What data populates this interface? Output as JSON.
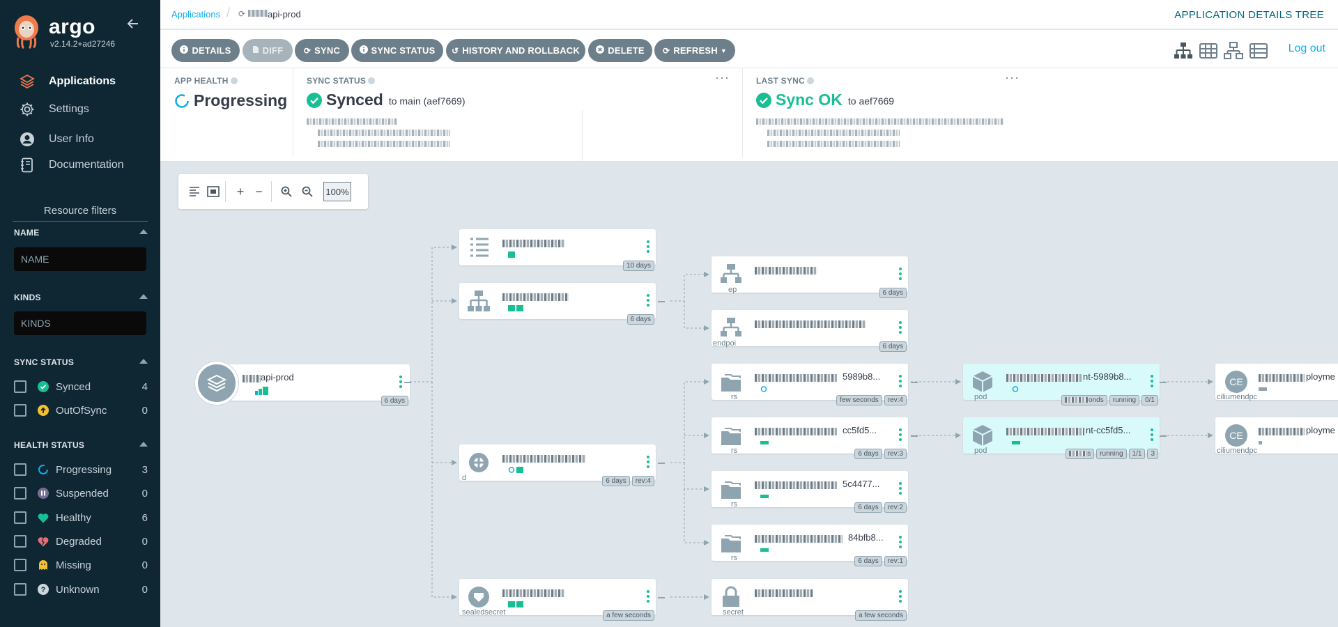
{
  "brand": {
    "name": "argo",
    "version": "v2.14.2+ad27246"
  },
  "nav": [
    {
      "label": "Applications",
      "icon": "layers-icon",
      "active": true
    },
    {
      "label": "Settings",
      "icon": "gear-icon",
      "active": false
    },
    {
      "label": "User Info",
      "icon": "user-circle-icon",
      "active": false
    },
    {
      "label": "Documentation",
      "icon": "book-icon",
      "active": false
    }
  ],
  "filters": {
    "title": "Resource filters",
    "name": {
      "label": "NAME",
      "placeholder": "NAME"
    },
    "kinds": {
      "label": "KINDS",
      "placeholder": "KINDS"
    },
    "sync_status": {
      "label": "SYNC STATUS",
      "items": [
        {
          "label": "Synced",
          "count": "4",
          "icon": "check-circle-icon"
        },
        {
          "label": "OutOfSync",
          "count": "0",
          "icon": "arrow-up-circle-icon"
        }
      ]
    },
    "health_status": {
      "label": "HEALTH STATUS",
      "items": [
        {
          "label": "Progressing",
          "count": "3",
          "icon": "progress-ring-icon"
        },
        {
          "label": "Suspended",
          "count": "0",
          "icon": "pause-circle-icon"
        },
        {
          "label": "Healthy",
          "count": "6",
          "icon": "heart-icon"
        },
        {
          "label": "Degraded",
          "count": "0",
          "icon": "broken-heart-icon"
        },
        {
          "label": "Missing",
          "count": "0",
          "icon": "ghost-icon"
        },
        {
          "label": "Unknown",
          "count": "0",
          "icon": "question-circle-icon"
        }
      ]
    }
  },
  "breadcrumb": {
    "root": "Applications",
    "current": "api-prod"
  },
  "page_title": "APPLICATION DETAILS TREE",
  "toolbar": {
    "details": "DETAILS",
    "diff": "DIFF",
    "sync": "SYNC",
    "sync_status": "SYNC STATUS",
    "history": "HISTORY AND ROLLBACK",
    "delete": "DELETE",
    "refresh": "REFRESH",
    "logout": "Log out"
  },
  "status": {
    "app_health": {
      "label": "APP HEALTH",
      "value": "Progressing"
    },
    "sync_status": {
      "label": "SYNC STATUS",
      "value": "Synced",
      "sub": "to main (aef7669)"
    },
    "last_sync": {
      "label": "LAST SYNC",
      "value": "Sync OK",
      "sub": "to aef7669"
    }
  },
  "zoom": {
    "level": "100%"
  },
  "graph": {
    "root": {
      "name": "api-prod",
      "age": "6 days"
    },
    "nodes": {
      "configmap": {
        "kind": "",
        "age": "10 days"
      },
      "service": {
        "kind": "",
        "age": "6 days"
      },
      "deploy": {
        "kind": "d",
        "age": "6 days",
        "rev": "rev:4"
      },
      "sealedsecret": {
        "kind": "sealedsecret",
        "age": "a few seconds"
      },
      "ep": {
        "kind": "ep",
        "age": "6 days"
      },
      "endpointslice": {
        "kind": "endpoi",
        "age": "6 days"
      },
      "rs1": {
        "kind": "rs",
        "name": "5989b8...",
        "age": "few seconds",
        "rev": "rev:4"
      },
      "rs2": {
        "kind": "rs",
        "name": "cc5fd5...",
        "age": "6 days",
        "rev": "rev:3"
      },
      "rs3": {
        "kind": "rs",
        "name": "5c4477...",
        "age": "6 days",
        "rev": "rev:2"
      },
      "rs4": {
        "kind": "rs",
        "name": "84bfb8...",
        "age": "6 days",
        "rev": "rev:1"
      },
      "secret": {
        "kind": "secret",
        "age": "a few seconds"
      },
      "pod1": {
        "kind": "pod",
        "name": "nt-5989b8...",
        "age": "onds",
        "state": "running",
        "ready": "0/1"
      },
      "pod2": {
        "kind": "pod",
        "name": "nt-cc5fd5...",
        "age": "s",
        "state": "running",
        "ready": "1/1",
        "restarts": "3"
      },
      "cep1": {
        "kind": "ciliumendpc",
        "name": "ployme",
        "badge": "CE"
      },
      "cep2": {
        "kind": "ciliumendpc",
        "name": "ployme",
        "badge": "CE"
      }
    }
  },
  "colors": {
    "sidebar": "#0f2733",
    "accent": "#0dadea",
    "healthy": "#18be94",
    "progressing": "#0dadea",
    "title": "#00667c"
  }
}
